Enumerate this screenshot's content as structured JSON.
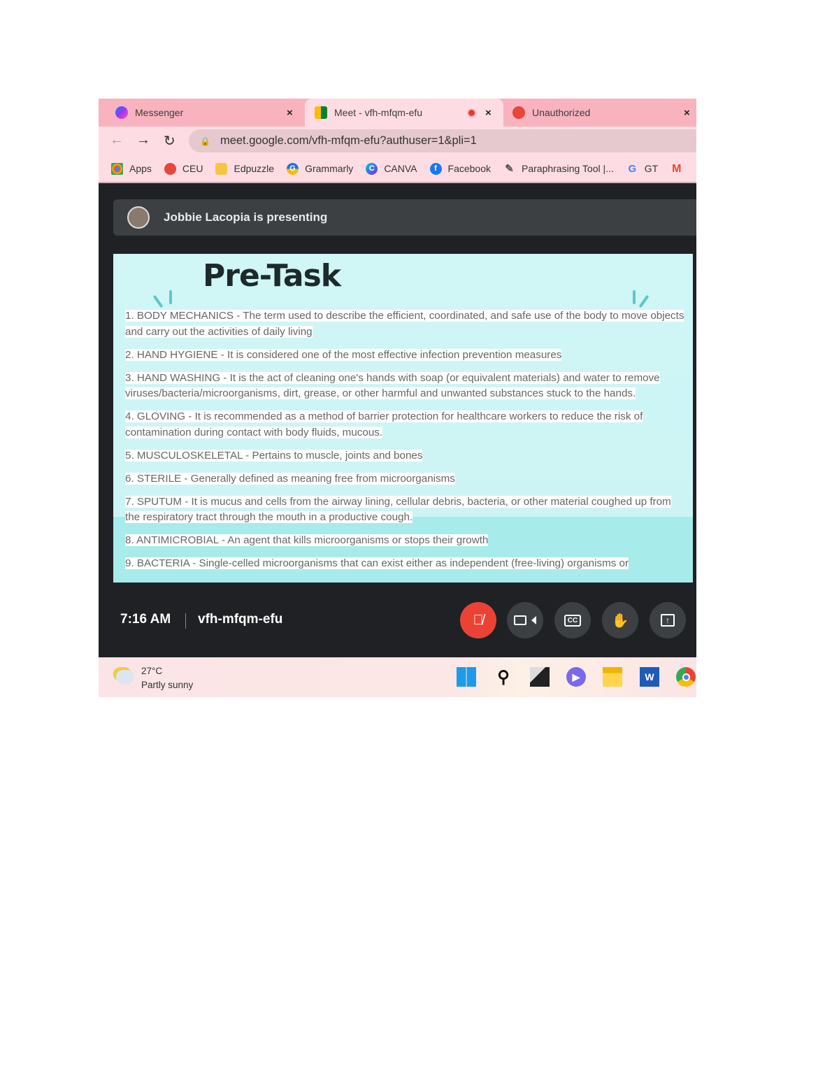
{
  "browser": {
    "tabs": [
      {
        "label": "Messenger",
        "close": "×",
        "recording": false
      },
      {
        "label": "Meet - vfh-mfqm-efu",
        "close": "×",
        "recording": true,
        "active": true
      },
      {
        "label": "Unauthorized",
        "close": "×"
      }
    ],
    "url": "meet.google.com/vfh-mfqm-efu?authuser=1&pli=1",
    "bookmarks": [
      "Apps",
      "CEU",
      "Edpuzzle",
      "Grammarly",
      "CANVA",
      "Facebook",
      "Paraphrasing Tool |...",
      "GT"
    ]
  },
  "meet": {
    "presenting": "Jobbie Lacopia is presenting",
    "slide": {
      "title": "Pre-Task",
      "items": [
        "1. BODY MECHANICS - The term used to describe the efficient, coordinated, and safe use of the body to move objects and carry out the activities of daily living",
        "2. HAND HYGIENE - It is considered one of the most effective infection prevention measures",
        "3. HAND WASHING - It is the act of cleaning one's hands with soap (or equivalent materials) and water to remove viruses/bacteria/microorganisms, dirt, grease, or other harmful and unwanted substances stuck to the hands.",
        "4. GLOVING - It is recommended as a method of barrier protection for healthcare workers to reduce the risk of contamination during contact with body fluids, mucous.",
        "5. MUSCULOSKELETAL - Pertains to muscle, joints and bones",
        "6. STERILE - Generally defined as meaning free from microorganisms",
        "7. SPUTUM - It is mucus and cells from the airway lining, cellular debris, bacteria, or other material coughed up from the respiratory tract through the mouth in a productive cough.",
        "8. ANTIMICROBIAL - An agent that kills microorganisms or stops their growth",
        "9. BACTERIA - Single-celled microorganisms that can exist either as independent (free-living) organisms or"
      ]
    },
    "time": "7:16 AM",
    "meeting_code": "vfh-mfqm-efu",
    "controls": [
      "mic-off",
      "camera",
      "captions",
      "raise-hand",
      "present"
    ],
    "mic_color": "#ea4335"
  },
  "taskbar": {
    "temperature": "27°C",
    "weather": "Partly sunny",
    "word_letter": "W"
  }
}
